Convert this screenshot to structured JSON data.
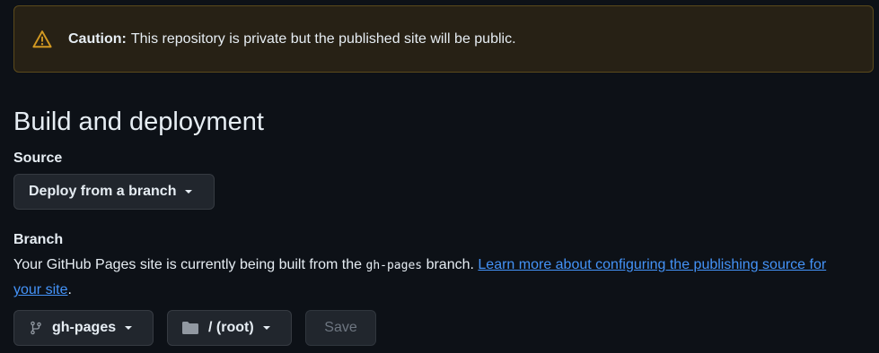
{
  "caution": {
    "label": "Caution:",
    "message": "This repository is private but the published site will be public."
  },
  "section": {
    "title": "Build and deployment"
  },
  "source": {
    "label": "Source",
    "dropdown_value": "Deploy from a branch"
  },
  "branch": {
    "label": "Branch",
    "desc_before": "Your GitHub Pages site is currently being built from the ",
    "branch_code": "gh-pages",
    "desc_after": " branch. ",
    "link_text": "Learn more about configuring the publishing source for your site",
    "period": ".",
    "branch_button": "gh-pages",
    "folder_button": "/ (root)",
    "save_button": "Save"
  },
  "colors": {
    "accent_link": "#4493f8",
    "warning": "#d29922"
  }
}
